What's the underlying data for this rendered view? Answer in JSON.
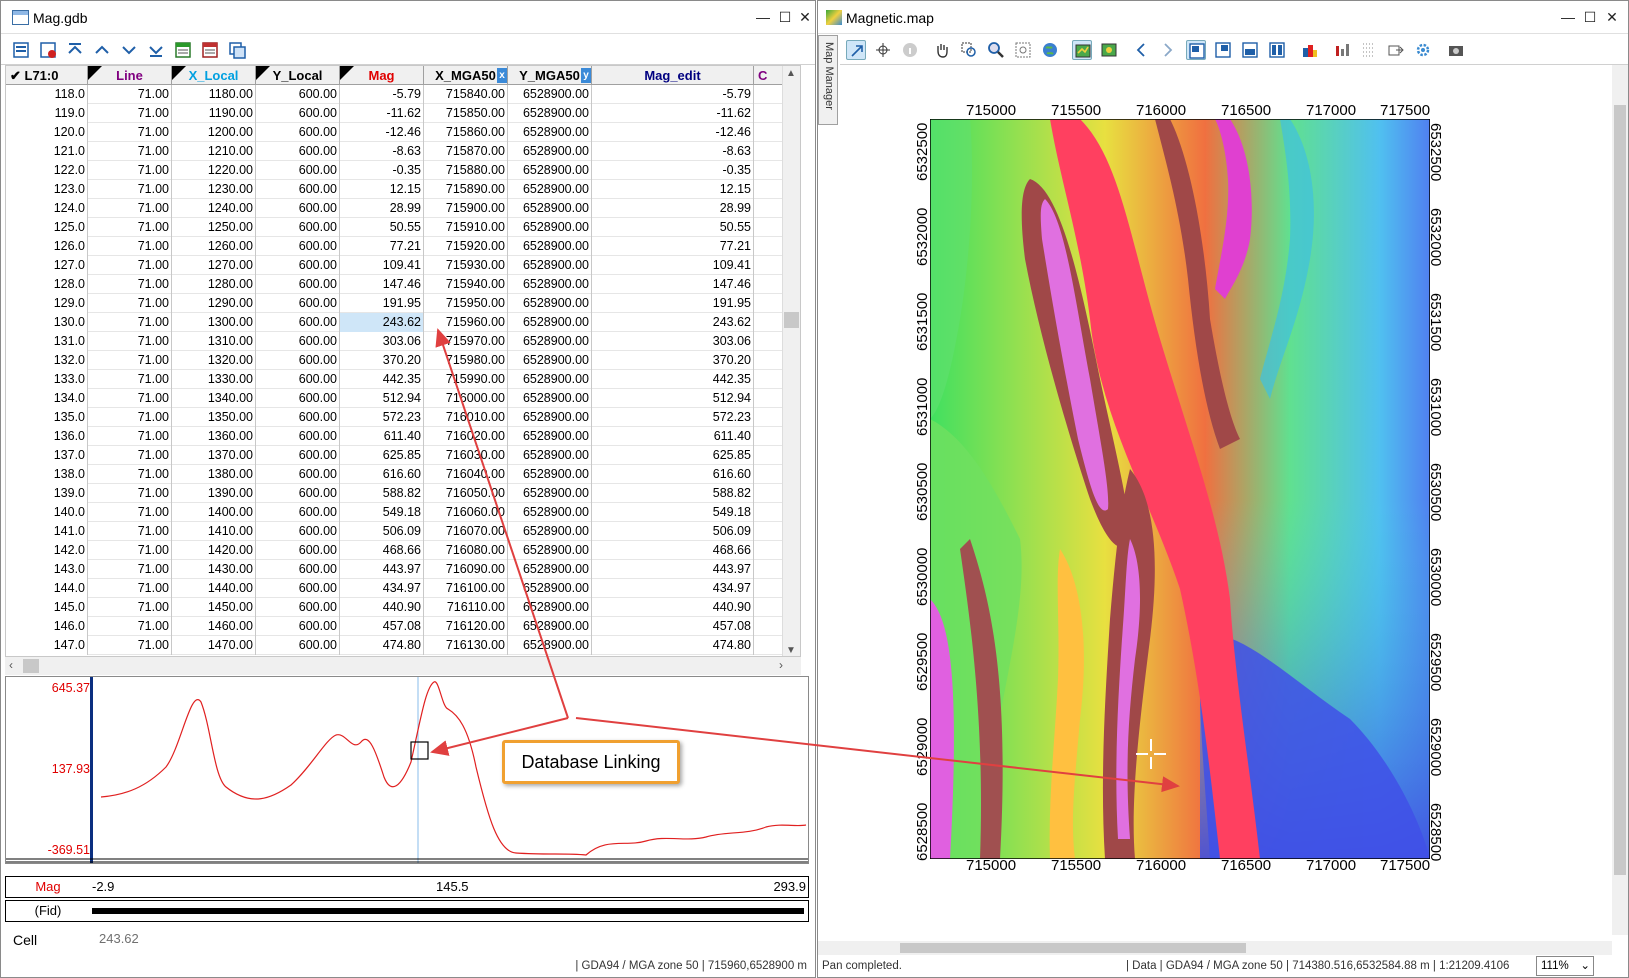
{
  "left_window": {
    "title": "Mag.gdb",
    "controls": [
      "—",
      "☐",
      "✕"
    ]
  },
  "grid": {
    "line_label": "L71:0",
    "headers": [
      "Line",
      "X_Local",
      "Y_Local",
      "Mag",
      "X_MGA50",
      "Y_MGA50",
      "Mag_edit",
      "C"
    ],
    "header_colors": [
      "#800080",
      "#00a0e0",
      "#000000",
      "#e00000",
      "#000000",
      "#000000",
      "#000080",
      "#800080"
    ],
    "x_badge": "x",
    "y_badge": "y",
    "rows": [
      [
        "118.0",
        "71.00",
        "1180.00",
        "600.00",
        "-5.79",
        "715840.00",
        "6528900.00",
        "-5.79"
      ],
      [
        "119.0",
        "71.00",
        "1190.00",
        "600.00",
        "-11.62",
        "715850.00",
        "6528900.00",
        "-11.62"
      ],
      [
        "120.0",
        "71.00",
        "1200.00",
        "600.00",
        "-12.46",
        "715860.00",
        "6528900.00",
        "-12.46"
      ],
      [
        "121.0",
        "71.00",
        "1210.00",
        "600.00",
        "-8.63",
        "715870.00",
        "6528900.00",
        "-8.63"
      ],
      [
        "122.0",
        "71.00",
        "1220.00",
        "600.00",
        "-0.35",
        "715880.00",
        "6528900.00",
        "-0.35"
      ],
      [
        "123.0",
        "71.00",
        "1230.00",
        "600.00",
        "12.15",
        "715890.00",
        "6528900.00",
        "12.15"
      ],
      [
        "124.0",
        "71.00",
        "1240.00",
        "600.00",
        "28.99",
        "715900.00",
        "6528900.00",
        "28.99"
      ],
      [
        "125.0",
        "71.00",
        "1250.00",
        "600.00",
        "50.55",
        "715910.00",
        "6528900.00",
        "50.55"
      ],
      [
        "126.0",
        "71.00",
        "1260.00",
        "600.00",
        "77.21",
        "715920.00",
        "6528900.00",
        "77.21"
      ],
      [
        "127.0",
        "71.00",
        "1270.00",
        "600.00",
        "109.41",
        "715930.00",
        "6528900.00",
        "109.41"
      ],
      [
        "128.0",
        "71.00",
        "1280.00",
        "600.00",
        "147.46",
        "715940.00",
        "6528900.00",
        "147.46"
      ],
      [
        "129.0",
        "71.00",
        "1290.00",
        "600.00",
        "191.95",
        "715950.00",
        "6528900.00",
        "191.95"
      ],
      [
        "130.0",
        "71.00",
        "1300.00",
        "600.00",
        "243.62",
        "715960.00",
        "6528900.00",
        "243.62"
      ],
      [
        "131.0",
        "71.00",
        "1310.00",
        "600.00",
        "303.06",
        "715970.00",
        "6528900.00",
        "303.06"
      ],
      [
        "132.0",
        "71.00",
        "1320.00",
        "600.00",
        "370.20",
        "715980.00",
        "6528900.00",
        "370.20"
      ],
      [
        "133.0",
        "71.00",
        "1330.00",
        "600.00",
        "442.35",
        "715990.00",
        "6528900.00",
        "442.35"
      ],
      [
        "134.0",
        "71.00",
        "1340.00",
        "600.00",
        "512.94",
        "716000.00",
        "6528900.00",
        "512.94"
      ],
      [
        "135.0",
        "71.00",
        "1350.00",
        "600.00",
        "572.23",
        "716010.00",
        "6528900.00",
        "572.23"
      ],
      [
        "136.0",
        "71.00",
        "1360.00",
        "600.00",
        "611.40",
        "716020.00",
        "6528900.00",
        "611.40"
      ],
      [
        "137.0",
        "71.00",
        "1370.00",
        "600.00",
        "625.85",
        "716030.00",
        "6528900.00",
        "625.85"
      ],
      [
        "138.0",
        "71.00",
        "1380.00",
        "600.00",
        "616.60",
        "716040.00",
        "6528900.00",
        "616.60"
      ],
      [
        "139.0",
        "71.00",
        "1390.00",
        "600.00",
        "588.82",
        "716050.00",
        "6528900.00",
        "588.82"
      ],
      [
        "140.0",
        "71.00",
        "1400.00",
        "600.00",
        "549.18",
        "716060.00",
        "6528900.00",
        "549.18"
      ],
      [
        "141.0",
        "71.00",
        "1410.00",
        "600.00",
        "506.09",
        "716070.00",
        "6528900.00",
        "506.09"
      ],
      [
        "142.0",
        "71.00",
        "1420.00",
        "600.00",
        "468.66",
        "716080.00",
        "6528900.00",
        "468.66"
      ],
      [
        "143.0",
        "71.00",
        "1430.00",
        "600.00",
        "443.97",
        "716090.00",
        "6528900.00",
        "443.97"
      ],
      [
        "144.0",
        "71.00",
        "1440.00",
        "600.00",
        "434.97",
        "716100.00",
        "6528900.00",
        "434.97"
      ],
      [
        "145.0",
        "71.00",
        "1450.00",
        "600.00",
        "440.90",
        "716110.00",
        "6528900.00",
        "440.90"
      ],
      [
        "146.0",
        "71.00",
        "1460.00",
        "600.00",
        "457.08",
        "716120.00",
        "6528900.00",
        "457.08"
      ],
      [
        "147.0",
        "71.00",
        "1470.00",
        "600.00",
        "474.80",
        "716130.00",
        "6528900.00",
        "474.80"
      ]
    ],
    "selected_row": 12,
    "selected_col": 4
  },
  "profile": {
    "y_max": "645.37",
    "y_mid": "137.93",
    "y_min": "-369.51"
  },
  "ruler": {
    "channel": "Mag",
    "start": "-2.9",
    "mid": "145.5",
    "end": "293.9",
    "fid_label": "(Fid)"
  },
  "cell": {
    "label": "Cell",
    "value": "243.62"
  },
  "left_status": "| GDA94 / MGA zone 50  | 715960,6528900 m",
  "right_window": {
    "title": "Magnetic.map",
    "controls": [
      "—",
      "☐",
      "✕"
    ],
    "map_manager_label": "Map Manager"
  },
  "map": {
    "x_ticks": [
      "715000",
      "715500",
      "716000",
      "716500",
      "717000",
      "717500"
    ],
    "y_ticks": [
      "6532500",
      "6532000",
      "6531500",
      "6531000",
      "6530500",
      "6530000",
      "6529500",
      "6529000",
      "6528500"
    ]
  },
  "callout": {
    "text": "Database Linking"
  },
  "right_status": {
    "message": "Pan completed.",
    "info": "| Data  | GDA94 / MGA zone 50  | 714380.516,6532584.88 m  | 1:21209.4106",
    "zoom": "111%"
  }
}
